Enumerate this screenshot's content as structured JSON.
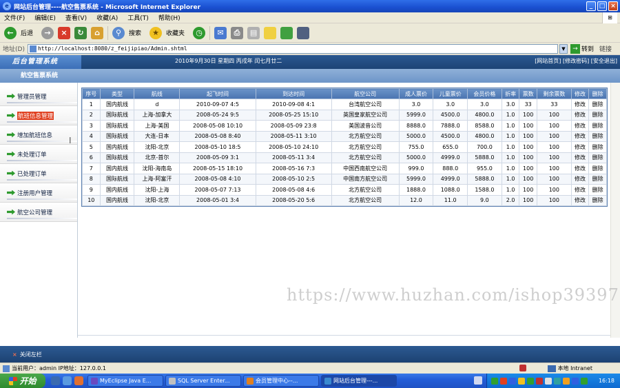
{
  "window": {
    "title": "网站后台管理----航空售票系统 - Microsoft Internet Explorer",
    "ie_icon": "e",
    "buttons": [
      "_",
      "□",
      "×"
    ]
  },
  "menubar": {
    "items": [
      "文件(F)",
      "编辑(E)",
      "查看(V)",
      "收藏(A)",
      "工具(T)",
      "帮助(H)"
    ]
  },
  "toolbar": {
    "back_label": "后退",
    "search_label": "搜索",
    "favorites_label": "收藏夹"
  },
  "address": {
    "label": "地址(D)",
    "url": "http://localhost:8080/z_feijipiao/Admin.shtml",
    "go_label": "转到",
    "links_label": "链接"
  },
  "header": {
    "logo": "后台管理系统",
    "subtitle": "航空售票系统",
    "date": "2010年9月30日 星期四 丙戌年 闰七月廿二",
    "links": "[网站首页] [修改密码] [安全退出]"
  },
  "sidebar": {
    "items": [
      {
        "label": "管理员管理"
      },
      {
        "label": "航班信息管理"
      },
      {
        "label": "增加航班信息"
      },
      {
        "label": "未处理订单"
      },
      {
        "label": "已处理订单"
      },
      {
        "label": "注册用户管理"
      },
      {
        "label": "航空公司管理"
      }
    ]
  },
  "table": {
    "headers": [
      "序号",
      "类型",
      "航线",
      "起飞时间",
      "到达时间",
      "航空公司",
      "成人票价",
      "儿童票价",
      "会员价格",
      "折率",
      "票数",
      "剩余票数",
      "修改",
      "删除"
    ],
    "rows": [
      [
        "1",
        "国内航线",
        "d",
        "2010-09-07 4:5",
        "2010-09-08 4:1",
        "台湾航空公司",
        "3.0",
        "3.0",
        "3.0",
        "3.0",
        "33",
        "33",
        "修改",
        "删除"
      ],
      [
        "2",
        "国际航线",
        "上海-加拿大",
        "2008-05-24 9:5",
        "2008-05-25 15:10",
        "英国皇家航空公司",
        "5999.0",
        "4500.0",
        "4800.0",
        "1.0",
        "100",
        "100",
        "修改",
        "删除"
      ],
      [
        "3",
        "国际航线",
        "上海-美国",
        "2008-05-08 10:10",
        "2008-05-09 23:8",
        "美国波音公司",
        "8888.0",
        "7888.0",
        "8588.0",
        "1.0",
        "100",
        "100",
        "修改",
        "删除"
      ],
      [
        "4",
        "国际航线",
        "大连-日本",
        "2008-05-08 8:40",
        "2008-05-11 3:10",
        "北方航空公司",
        "5000.0",
        "4500.0",
        "4800.0",
        "1.0",
        "100",
        "100",
        "修改",
        "删除"
      ],
      [
        "5",
        "国内航线",
        "沈阳-北京",
        "2008-05-10 18:5",
        "2008-05-10 24:10",
        "北方航空公司",
        "755.0",
        "655.0",
        "700.0",
        "1.0",
        "100",
        "100",
        "修改",
        "删除"
      ],
      [
        "6",
        "国际航线",
        "北京-首尔",
        "2008-05-09 3:1",
        "2008-05-11 3:4",
        "北方航空公司",
        "5000.0",
        "4999.0",
        "5888.0",
        "1.0",
        "100",
        "100",
        "修改",
        "删除"
      ],
      [
        "7",
        "国内航线",
        "沈阳-海南岛",
        "2008-05-15 18:10",
        "2008-05-16 7:3",
        "中国西南航空公司",
        "999.0",
        "888.0",
        "955.0",
        "1.0",
        "100",
        "100",
        "修改",
        "删除"
      ],
      [
        "8",
        "国际航线",
        "上海-阿富汗",
        "2008-05-08 4:10",
        "2008-05-10 2:5",
        "中国南方航空公司",
        "5999.0",
        "4999.0",
        "5888.0",
        "1.0",
        "100",
        "100",
        "修改",
        "删除"
      ],
      [
        "9",
        "国内航线",
        "沈阳-上海",
        "2008-05-07 7:13",
        "2008-05-08 4:6",
        "北方航空公司",
        "1888.0",
        "1088.0",
        "1588.0",
        "1.0",
        "100",
        "100",
        "修改",
        "删除"
      ],
      [
        "10",
        "国内航线",
        "沈阳-北京",
        "2008-05-01 3:4",
        "2008-05-20 5:6",
        "北方航空公司",
        "12.0",
        "11.0",
        "9.0",
        "2.0",
        "100",
        "100",
        "修改",
        "删除"
      ]
    ]
  },
  "watermark": "https://www.huzhan.com/ishop39397",
  "bottombar": {
    "close_icon": "×",
    "close_label": "关闭左栏"
  },
  "statusbar": {
    "text": "当前用户：admin  IP地址：127.0.0.1",
    "zone": "本地 Intranet"
  },
  "taskbar": {
    "start_label": "开始",
    "tasks": [
      {
        "label": "MyEclipse Java E...",
        "color": "#6a4ac0"
      },
      {
        "label": "SQL Server Enter...",
        "color": "#c0c0c0"
      },
      {
        "label": "会员管理中心--...",
        "color": "#e08020"
      },
      {
        "label": "网站后台管理---...",
        "color": "#3a8ad0"
      }
    ],
    "clock": "16:18"
  }
}
